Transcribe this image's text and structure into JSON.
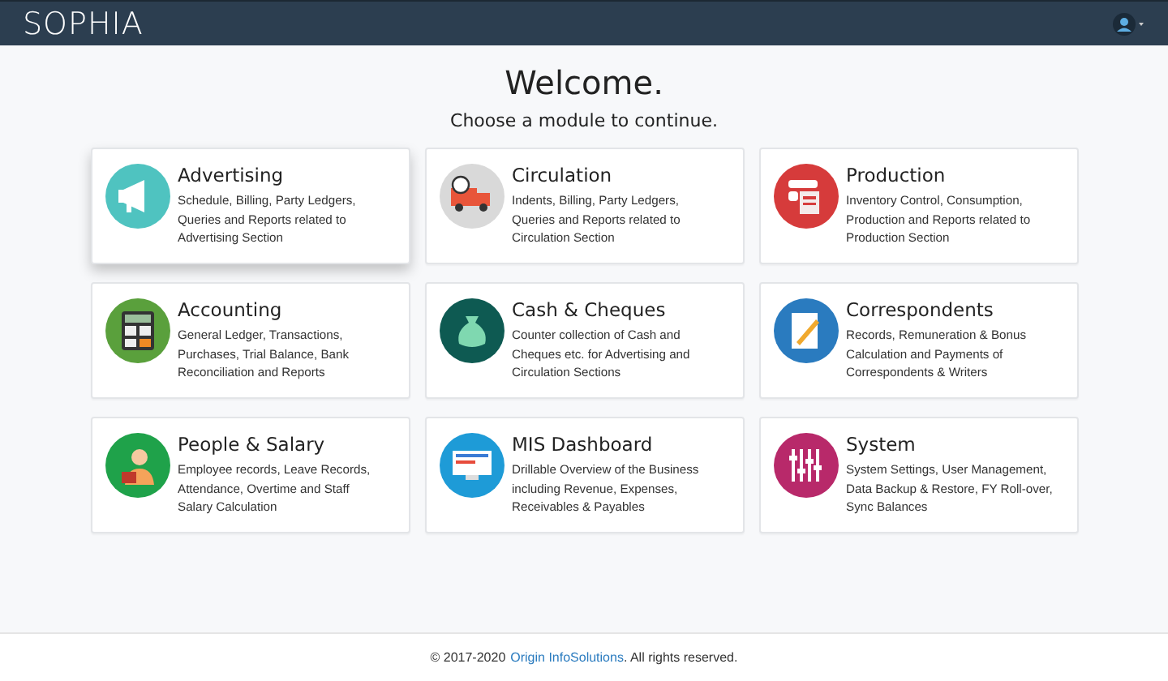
{
  "header": {
    "brand": "SOPHIA"
  },
  "welcome": {
    "title": "Welcome.",
    "subtitle": "Choose a module to continue."
  },
  "modules": [
    {
      "kind": "megaphone",
      "color": "#4fc3c0",
      "title": "Advertising",
      "description": "Schedule, Billing, Party Ledgers,\nQueries and Reports related to\nAdvertising Section",
      "selected": true
    },
    {
      "kind": "truck",
      "color": "#d9d9d9",
      "title": "Circulation",
      "description": "Indents, Billing, Party Ledgers,\nQueries and Reports related to\nCirculation Section",
      "selected": false
    },
    {
      "kind": "printer",
      "color": "#d63b3b",
      "title": "Production",
      "description": "Inventory Control, Consumption,\nProduction and Reports related to\nProduction Section",
      "selected": false
    },
    {
      "kind": "calculator",
      "color": "#5aa03c",
      "title": "Accounting",
      "description": "General Ledger, Transactions,\nPurchases, Trial Balance, Bank\nReconciliation and Reports",
      "selected": false
    },
    {
      "kind": "moneybag",
      "color": "#0e5a52",
      "title": "Cash & Cheques",
      "description": "Counter collection of Cash and\nCheques etc. for Advertising and\nCirculation Sections",
      "selected": false
    },
    {
      "kind": "document",
      "color": "#2a7bbf",
      "title": "Correspondents",
      "description": "Records, Remuneration & Bonus\nCalculation and Payments of\nCorrespondents & Writers",
      "selected": false
    },
    {
      "kind": "person",
      "color": "#1fa24a",
      "title": "People & Salary",
      "description": "Employee records, Leave Records,\nAttendance, Overtime and Staff\nSalary Calculation",
      "selected": false
    },
    {
      "kind": "monitor",
      "color": "#1e9bd7",
      "title": "MIS Dashboard",
      "description": "Drillable Overview of the Business\nincluding Revenue, Expenses,\nReceivables & Payables",
      "selected": false
    },
    {
      "kind": "sliders",
      "color": "#b8296a",
      "title": "System",
      "description": "System Settings, User Management,\nData Backup & Restore, FY Roll-over,\nSync Balances",
      "selected": false
    }
  ],
  "footer": {
    "prefix": "© 2017-2020",
    "link": "Origin InfoSolutions",
    "suffix": ". All rights reserved."
  }
}
